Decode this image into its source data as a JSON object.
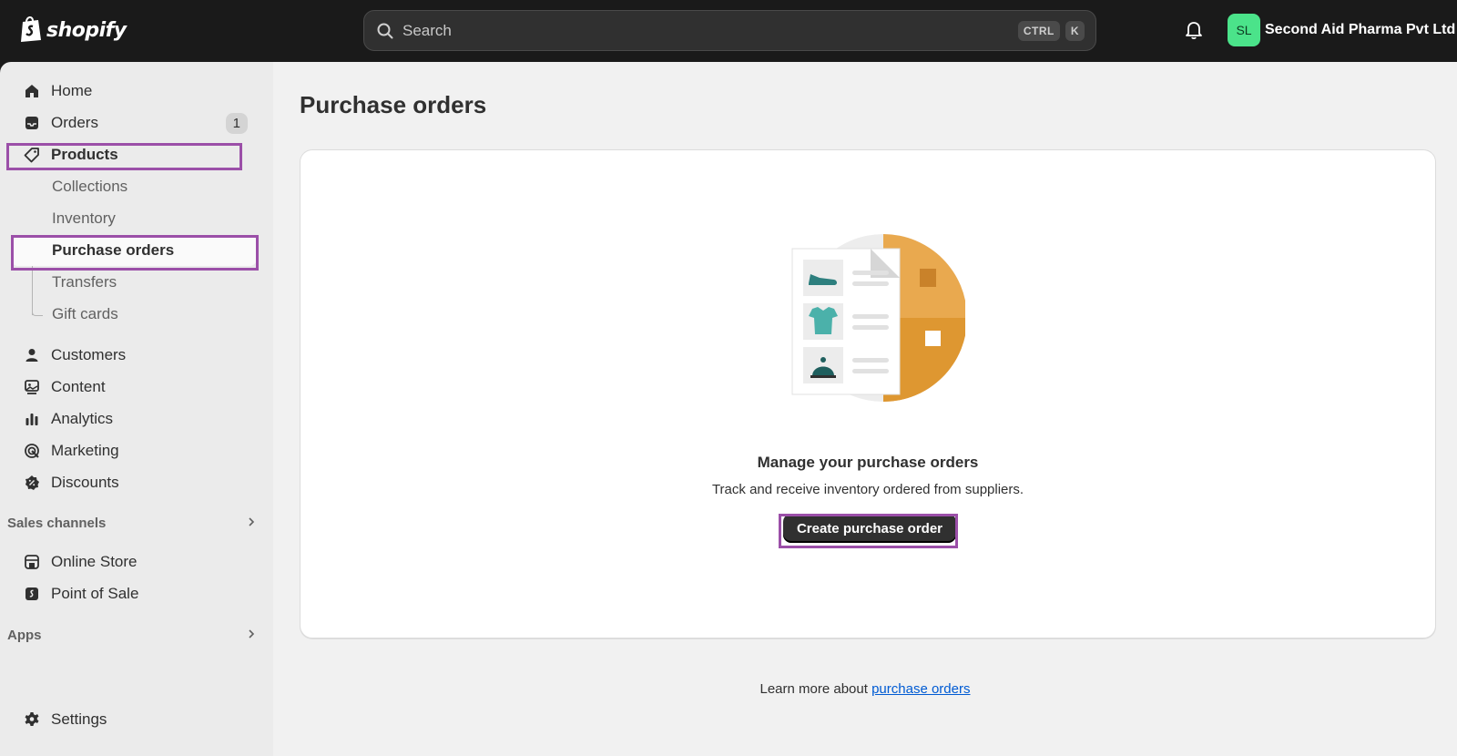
{
  "app": {
    "logo_text": "shopify"
  },
  "search": {
    "placeholder": "Search",
    "shortcut_key1": "CTRL",
    "shortcut_key2": "K"
  },
  "store": {
    "avatar_initials": "SL",
    "name": "Second Aid Pharma Pvt Ltd",
    "avatar_color": "#4be38a"
  },
  "sidebar": {
    "items": [
      {
        "label": "Home",
        "icon": "home-icon"
      },
      {
        "label": "Orders",
        "icon": "inbox-icon",
        "badge": "1"
      },
      {
        "label": "Products",
        "icon": "tag-icon"
      },
      {
        "label": "Collections"
      },
      {
        "label": "Inventory"
      },
      {
        "label": "Purchase orders"
      },
      {
        "label": "Transfers"
      },
      {
        "label": "Gift cards"
      },
      {
        "label": "Customers",
        "icon": "person-icon"
      },
      {
        "label": "Content",
        "icon": "image-icon"
      },
      {
        "label": "Analytics",
        "icon": "bar-chart-icon"
      },
      {
        "label": "Marketing",
        "icon": "target-icon"
      },
      {
        "label": "Discounts",
        "icon": "discount-icon"
      }
    ],
    "sales_channels": {
      "title": "Sales channels",
      "items": [
        {
          "label": "Online Store",
          "icon": "store-icon"
        },
        {
          "label": "Point of Sale",
          "icon": "pos-icon"
        }
      ]
    },
    "apps": {
      "title": "Apps"
    },
    "settings": {
      "label": "Settings",
      "icon": "gear-icon"
    }
  },
  "main": {
    "page_title": "Purchase orders",
    "empty_state": {
      "title": "Manage your purchase orders",
      "description": "Track and receive inventory ordered from suppliers.",
      "button_label": "Create purchase order"
    },
    "learn_more_prefix": "Learn more about",
    "learn_more_link": "purchase orders"
  },
  "colors": {
    "highlight": "#9b4fa8",
    "topbar": "#1a1a1a",
    "link": "#005bd3",
    "primary_button": "#303030"
  }
}
